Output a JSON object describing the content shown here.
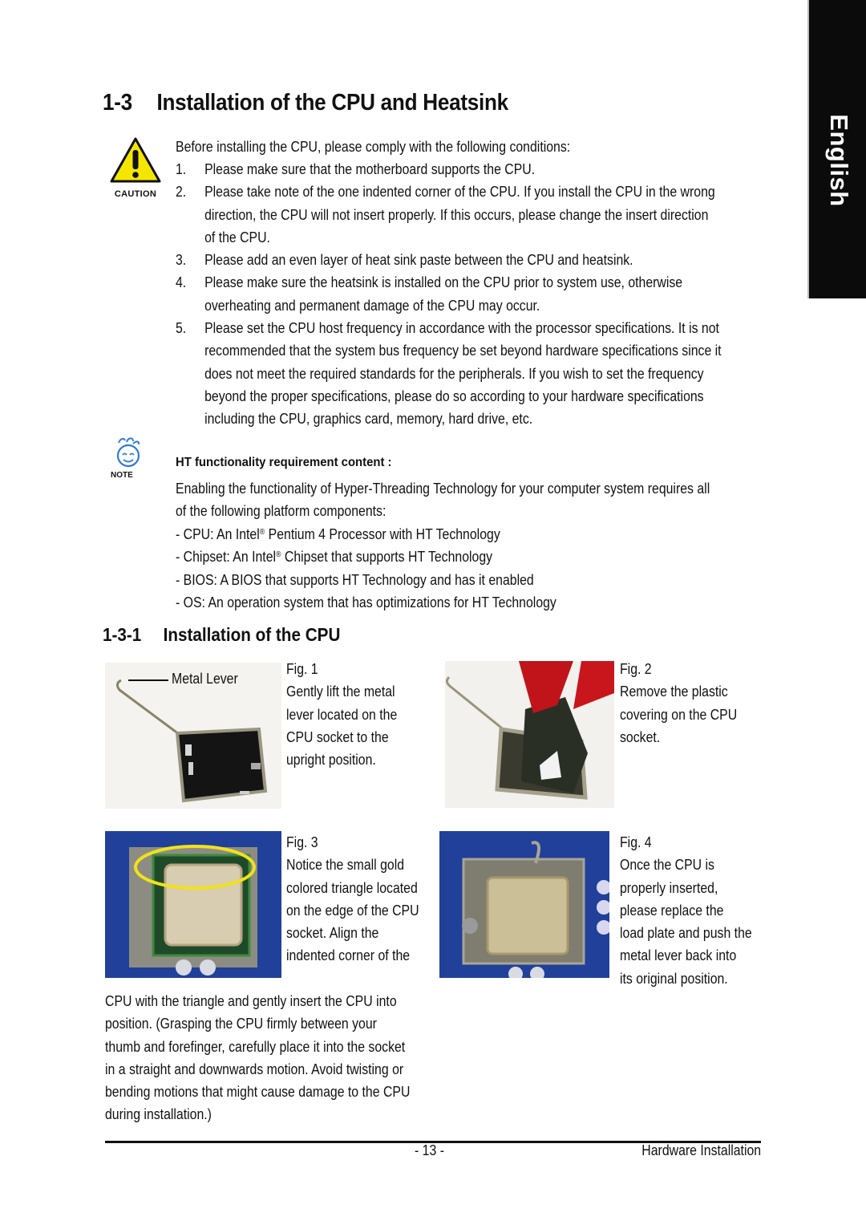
{
  "side_tab": {
    "label": "English"
  },
  "section": {
    "number": "1-3",
    "title": "Installation of the CPU and Heatsink"
  },
  "caution": {
    "icon_label": "CAUTION",
    "intro": "Before installing the CPU, please comply with the following conditions:",
    "items": [
      {
        "num": "1.",
        "lines": [
          "Please make sure that the motherboard supports the CPU."
        ]
      },
      {
        "num": "2.",
        "lines": [
          "Please take note of the one indented corner of the CPU.  If you install the CPU in the wrong",
          "direction, the CPU will not insert properly.  If this occurs, please change the insert direction",
          "of the CPU."
        ]
      },
      {
        "num": "3.",
        "lines": [
          "Please add an even layer of heat sink paste between the CPU and heatsink."
        ]
      },
      {
        "num": "4.",
        "lines": [
          "Please make sure the heatsink is installed on the CPU prior to system use, otherwise",
          "overheating and permanent damage of the CPU may occur."
        ]
      },
      {
        "num": "5.",
        "lines": [
          "Please set the CPU host frequency in accordance with the processor specifications.  It is not",
          "recommended that the system bus frequency be set beyond hardware specifications since it",
          "does not meet the required standards for the peripherals.  If you wish to set the frequency",
          "beyond the proper specifications, please do so according to your hardware specifications",
          "including the CPU, graphics card, memory, hard drive, etc."
        ]
      }
    ]
  },
  "note": {
    "icon_label": "NOTE",
    "title": "HT functionality requirement content :",
    "desc_lines": [
      "Enabling the functionality of Hyper-Threading Technology for your computer system requires all",
      "of the following platform components:"
    ],
    "components": [
      {
        "pre": "- CPU: An Intel",
        "sup": "®",
        "post": " Pentium 4 Processor with HT Technology"
      },
      {
        "pre": "- Chipset: An Intel",
        "sup": "®",
        "post": " Chipset that supports HT Technology"
      },
      {
        "pre": "- BIOS: A BIOS that supports HT Technology and has it enabled",
        "sup": "",
        "post": ""
      },
      {
        "pre": "- OS: An operation system that has optimizations for HT Technology",
        "sup": "",
        "post": ""
      }
    ]
  },
  "subsection": {
    "number": "1-3-1",
    "title": "Installation of the CPU"
  },
  "figures": [
    {
      "label": "Fig. 1",
      "callout": "Metal Lever",
      "lines": [
        "Gently lift the metal",
        "lever located on the",
        "CPU socket to the",
        "upright position."
      ]
    },
    {
      "label": "Fig. 2",
      "lines": [
        "Remove the plastic",
        "covering on the CPU",
        "socket."
      ]
    },
    {
      "label": "Fig. 3",
      "lines": [
        "Notice the small gold",
        "colored triangle located",
        "on the edge of the CPU",
        "socket.  Align the",
        "indented corner of the"
      ]
    },
    {
      "label": "Fig. 4",
      "lines": [
        "Once the CPU is",
        "properly inserted,",
        "please replace the",
        "load plate and push the",
        "metal lever back into",
        "its original position."
      ]
    }
  ],
  "fig3_continuation": [
    "CPU with the triangle and gently insert the CPU into",
    "position. (Grasping the CPU firmly between your",
    "thumb and forefinger, carefully place it into the socket",
    "in a straight and downwards motion. Avoid twisting or",
    "bending motions that might cause damage to the CPU",
    "during installation.)"
  ],
  "footer": {
    "page_number": "- 13 -",
    "section_name": "Hardware Installation"
  },
  "colors": {
    "caution_yellow": "#f5e600",
    "note_blue": "#2f7bd8",
    "highlight_ellipse": "#f0e21a",
    "side_tab_bg": "#0b0b0b"
  }
}
